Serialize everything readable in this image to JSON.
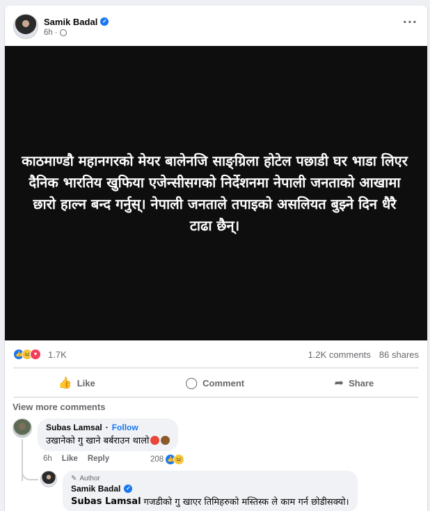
{
  "post": {
    "author": "Samik Badal",
    "time": "6h",
    "body": "काठमाण्डौ महानगरको मेयर बालेनजि साङ्ग्रिला होटेल पछाडी घर भाडा लिएर दैनिक भारतिय खुफिया एजेन्सीसगको निर्देशनमा नेपाली जनताको आखामा छारो हाल्न बन्द गर्नुस्। नेपाली जनताले तपाइको असलियत बुझ्ने दिन धैरै टाढा छैन्।"
  },
  "stats": {
    "reactions": "1.7K",
    "comments": "1.2K comments",
    "shares": "86 shares"
  },
  "actions": {
    "like": "Like",
    "comment": "Comment",
    "share": "Share"
  },
  "view_more": "View more comments",
  "comments": [
    {
      "author": "Subas Lamsal",
      "follow": "Follow",
      "text": "उखानेको गु खाने बर्बराउन थालो",
      "time": "6h",
      "like": "Like",
      "reply": "Reply",
      "reactions": "208"
    }
  ],
  "reply": {
    "badge": "Author",
    "author": "Samik Badal",
    "tag": "Subas Lamsal",
    "text": "गजडीको गु खाएर तिमिहरुको मस्तिस्क ले काम गर्न छोडीसक्यो।"
  },
  "colors": {
    "accent": "#1877f2",
    "post_bg": "#0e0e0f",
    "muted": "#65676b"
  }
}
